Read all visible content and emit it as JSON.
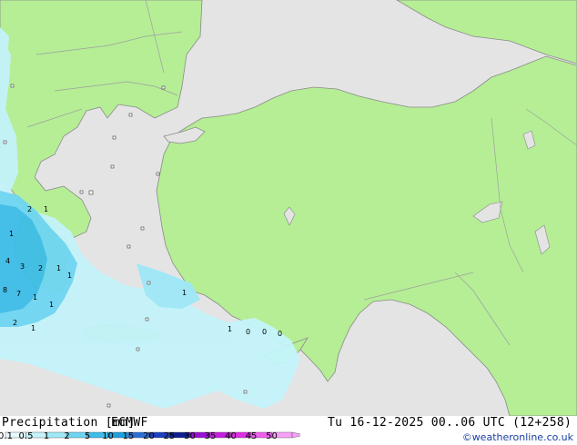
{
  "footer": {
    "title": "Precipitation [mm]",
    "model": "ECMWF",
    "valid_time": "Tu 16-12-2025 00..06 UTC (12+258)",
    "credit": "©weatheronline.co.uk"
  },
  "legend": {
    "labels": [
      "0.1",
      "0.5",
      "1",
      "2",
      "5",
      "10",
      "15",
      "20",
      "25",
      "30",
      "35",
      "40",
      "45",
      "50"
    ],
    "colors": [
      "#e6fbff",
      "#c4f3fb",
      "#9ee8f7",
      "#6fd6f2",
      "#3dbde9",
      "#1e9fe0",
      "#2b6fd6",
      "#1e3fbe",
      "#0f1f8f",
      "#9a10d6",
      "#c61ee0",
      "#e02ee6",
      "#f05ef0",
      "#f7a0f7"
    ]
  },
  "colors": {
    "land": "#b5ee95",
    "sea": "#e4e4e4",
    "coast": "#8a8a8a",
    "border": "#a0a0a0",
    "precip_light": "#c4f3fb",
    "precip_mid": "#6fd6f2",
    "precip_heavy": "#3dbde9"
  },
  "map": {
    "value_labels": [
      "1",
      "2",
      "3",
      "4",
      "7",
      "8",
      "1",
      "2",
      "1",
      "1",
      "1",
      "2",
      "1",
      "1",
      "1",
      "1",
      "0",
      "0",
      "0"
    ]
  }
}
